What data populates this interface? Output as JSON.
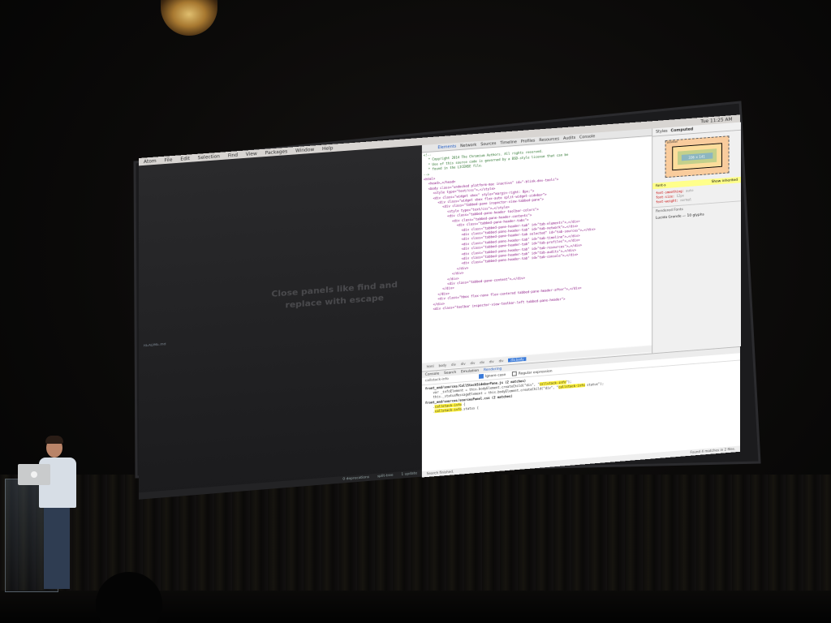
{
  "atom": {
    "menu": [
      "Atom",
      "File",
      "Edit",
      "Selection",
      "Find",
      "View",
      "Packages",
      "Window",
      "Help"
    ],
    "clock": "Tue 11:25 AM",
    "tree": [
      {
        "label": "",
        "sub": false
      },
      {
        "label": "",
        "sub": false
      },
      {
        "label": "",
        "sub": false
      },
      {
        "label": "",
        "sub": true
      },
      {
        "label": "",
        "sub": true
      },
      {
        "label": "",
        "sub": true
      },
      {
        "label": "",
        "sub": true
      },
      {
        "label": "",
        "sub": true
      },
      {
        "label": "",
        "sub": true
      },
      {
        "label": "",
        "sub": true
      },
      {
        "label": "",
        "sub": true
      },
      {
        "label": "",
        "sub": true
      },
      {
        "label": "",
        "sub": true
      },
      {
        "label": "",
        "sub": true
      },
      {
        "label": "",
        "sub": true
      },
      {
        "label": "",
        "sub": true
      },
      {
        "label": "",
        "sub": true
      },
      {
        "label": "",
        "sub": true
      },
      {
        "label": "",
        "sub": true
      },
      {
        "label": "",
        "sub": true
      },
      {
        "label": "",
        "sub": true
      },
      {
        "label": "",
        "sub": false
      },
      {
        "label": "",
        "sub": false
      },
      {
        "label": "",
        "sub": false
      },
      {
        "label": "",
        "sub": false
      },
      {
        "label": "",
        "sub": false
      },
      {
        "label": "",
        "sub": false
      },
      {
        "label": "",
        "sub": false
      },
      {
        "label": "",
        "sub": false
      },
      {
        "label": "",
        "sub": false
      },
      {
        "label": "README.md",
        "sub": false
      },
      {
        "label": "",
        "sub": false
      }
    ],
    "hint": "Close panels like find and replace with escape",
    "status": [
      "0 deprecations",
      "split-tree",
      "1 update"
    ]
  },
  "devtools": {
    "tabs": [
      "Elements",
      "Network",
      "Sources",
      "Timeline",
      "Profiles",
      "Resources",
      "Audits",
      "Console"
    ],
    "active_tab": "Elements",
    "dom_lines": [
      {
        "indent": 0,
        "kind": "comment",
        "text": "<!--"
      },
      {
        "indent": 1,
        "kind": "comment",
        "text": "* Copyright 2014 The Chromium Authors. All rights reserved."
      },
      {
        "indent": 1,
        "kind": "comment",
        "text": "* Use of this source code is governed by a BSD-style license that can be"
      },
      {
        "indent": 1,
        "kind": "comment",
        "text": "* found in the LICENSE file."
      },
      {
        "indent": 0,
        "kind": "comment",
        "text": "-->"
      },
      {
        "indent": 0,
        "kind": "tag",
        "text": "<html>"
      },
      {
        "indent": 1,
        "kind": "tag",
        "text": "<head>…</head>"
      },
      {
        "indent": 1,
        "kind": "mixed",
        "text": "<body class=\"undocked platform-mac inactive\" id=\"-blink-dev-tools\">"
      },
      {
        "indent": 2,
        "kind": "mixed",
        "text": "<style type=\"text/css\">…</style>"
      },
      {
        "indent": 2,
        "kind": "mixed",
        "text": "<div class=\"widget vbox\" style=\"margin-right: 0px;\">"
      },
      {
        "indent": 3,
        "kind": "mixed",
        "text": "<div class=\"widget vbox flex-auto split-widget-sidebar\">"
      },
      {
        "indent": 4,
        "kind": "mixed",
        "text": "<div class=\"tabbed-pane inspector-view-tabbed-pane\">"
      },
      {
        "indent": 5,
        "kind": "mixed",
        "text": "<style type=\"text/css\">…</style>"
      },
      {
        "indent": 5,
        "kind": "mixed",
        "text": "<div class=\"tabbed-pane-header toolbar-colors\">"
      },
      {
        "indent": 6,
        "kind": "mixed",
        "text": "<div class=\"tabbed-pane-header-contents\">"
      },
      {
        "indent": 7,
        "kind": "mixed",
        "text": "<div class=\"tabbed-pane-header-tabs\">"
      },
      {
        "indent": 8,
        "kind": "mixed",
        "text": "<div class=\"tabbed-pane-header-tab\" id=\"tab-elements\">…</div>"
      },
      {
        "indent": 8,
        "kind": "mixed",
        "text": "<div class=\"tabbed-pane-header-tab\" id=\"tab-network\">…</div>"
      },
      {
        "indent": 8,
        "kind": "mixed",
        "text": "<div class=\"tabbed-pane-header-tab selected\" id=\"tab-sources\">…</div>"
      },
      {
        "indent": 8,
        "kind": "mixed",
        "text": "<div class=\"tabbed-pane-header-tab\" id=\"tab-timeline\">…</div>"
      },
      {
        "indent": 8,
        "kind": "mixed",
        "text": "<div class=\"tabbed-pane-header-tab\" id=\"tab-profiles\">…</div>"
      },
      {
        "indent": 8,
        "kind": "mixed",
        "text": "<div class=\"tabbed-pane-header-tab\" id=\"tab-resources\">…</div>"
      },
      {
        "indent": 8,
        "kind": "mixed",
        "text": "<div class=\"tabbed-pane-header-tab\" id=\"tab-audits\">…</div>"
      },
      {
        "indent": 8,
        "kind": "mixed",
        "text": "<div class=\"tabbed-pane-header-tab\" id=\"tab-console\">…</div>"
      },
      {
        "indent": 7,
        "kind": "tag",
        "text": "</div>"
      },
      {
        "indent": 6,
        "kind": "tag",
        "text": "</div>"
      },
      {
        "indent": 5,
        "kind": "tag",
        "text": "</div>"
      },
      {
        "indent": 5,
        "kind": "mixed",
        "text": "<div class=\"tabbed-pane-content\">…</div>"
      },
      {
        "indent": 4,
        "kind": "tag",
        "text": "</div>"
      },
      {
        "indent": 3,
        "kind": "tag",
        "text": "</div>"
      },
      {
        "indent": 3,
        "kind": "mixed",
        "text": "<div class=\"hbox flex-none flex-centered tabbed-pane-header-after\">…</div>"
      },
      {
        "indent": 2,
        "kind": "tag",
        "text": "</div>"
      },
      {
        "indent": 2,
        "kind": "mixed",
        "text": "<div class=\"toolbar inspector-view-toolbar-left tabbed-pane-header\">"
      }
    ],
    "breadcrumb": [
      "html",
      "body",
      "div",
      "div",
      "div",
      "div",
      "div",
      "div",
      "div.body"
    ],
    "breadcrumb_selected": "div.body",
    "sidebar_tabs": [
      "Styles",
      "Computed"
    ],
    "sidebar_active": "Computed",
    "box_label": "position",
    "box_content": "336 × 141",
    "show_inherited": "Show inherited",
    "filter_label": "font-s",
    "props": [
      {
        "name": "font-smoothing:",
        "value": "auto"
      },
      {
        "name": "font-size:",
        "value": "12px"
      },
      {
        "name": "font-weight:",
        "value": "normal"
      }
    ],
    "rendered_fonts_title": "Rendered Fonts",
    "rendered_font": "Lucida Grande — 10 glyphs",
    "search_tabs": [
      "Console",
      "Search",
      "Emulation",
      "Rendering"
    ],
    "search_active": "Rendering",
    "search_query": "callstack-info",
    "ignore_case": "Ignore case",
    "regex": "Regular expression",
    "results": [
      {
        "kind": "file",
        "text": "front_end/sources/CallStackSidebarPane.js (2 matches)"
      },
      {
        "kind": "match",
        "before": "var _infoElement = this.bodyElement.createChild(\"div\", \"",
        "hl": "callstack-info",
        "after": "\");"
      },
      {
        "kind": "match",
        "before": "this._statusMessageElement = this.bodyElement.createChild(\"div\", \"",
        "hl": "callstack-info",
        "after": " status\");"
      },
      {
        "kind": "file",
        "text": "front_end/sources/sourcesPanel.css (2 matches)"
      },
      {
        "kind": "match",
        "before": ".",
        "hl": "callstack-info",
        "after": " {"
      },
      {
        "kind": "match",
        "before": ".",
        "hl": "callstack-info",
        "after": ".status {"
      }
    ],
    "search_finished": "Search finished.",
    "found": "Found 4 matches in 2 files."
  }
}
